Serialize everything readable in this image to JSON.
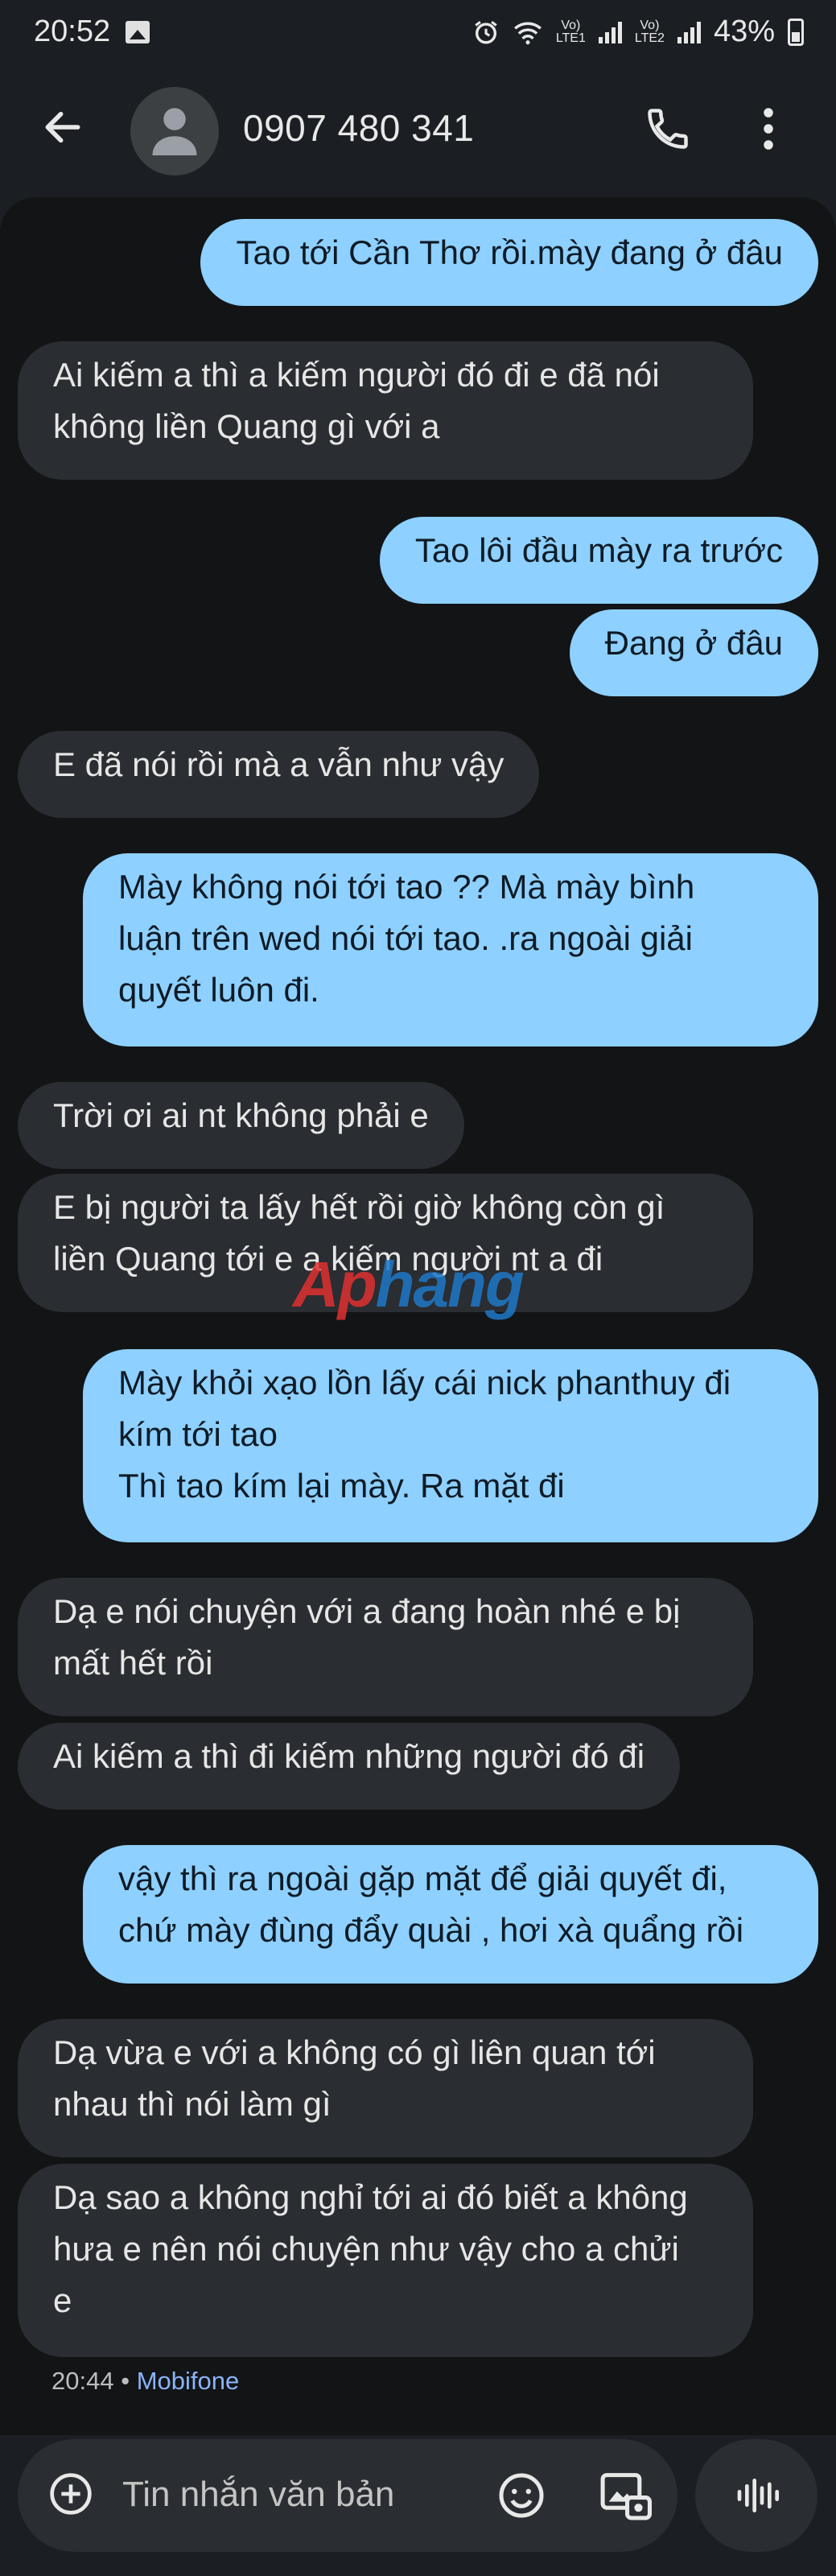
{
  "status_bar": {
    "time": "20:52",
    "battery": "43%",
    "sim1_label": "Vo)\nLTE1",
    "sim2_label": "Vo)\nLTE2",
    "icons": [
      "image-icon",
      "alarm-icon",
      "wifi-icon",
      "signal-icon",
      "battery-icon"
    ]
  },
  "app_bar": {
    "contact": "0907 480 341",
    "icons": [
      "back-arrow-icon",
      "person-icon",
      "phone-icon",
      "more-vert-icon"
    ]
  },
  "messages": [
    {
      "dir": "out",
      "text": "Tao tới Cần Thơ rồi.mày đang ở đâu"
    },
    {
      "dir": "in",
      "text": "Ai  kiếm a thì a kiếm người đó đi e đã nói\nkhông liền Quang gì với a"
    },
    {
      "dir": "out",
      "text": "Tao lôi  đầu mày ra trước"
    },
    {
      "dir": "out",
      "text": "Đang ở đâu"
    },
    {
      "dir": "in",
      "text": "E đã nói rồi mà a vẫn như vậy"
    },
    {
      "dir": "out",
      "text": "Mày không nói tới tao ?? Mà mày bình\nluận trên wed nói tới tao. .ra ngoài giải\nquyết luôn đi."
    },
    {
      "dir": "in",
      "text": "Trời ơi ai nt không phải e"
    },
    {
      "dir": "in",
      "text": "E bị người ta lấy hết rồi giờ không còn gì\nliền Quang tới e a kiếm người nt a đi"
    },
    {
      "dir": "out",
      "text": "Mày khỏi xạo lồn lấy cái nick phanthuy đi\nkím tới tao\nThì tao kím lại mày. Ra mặt đi"
    },
    {
      "dir": "in",
      "text": "Dạ e nói chuyện với a đang hoàn nhé e bị\nmất hết rồi"
    },
    {
      "dir": "in",
      "text": "Ai kiếm a thì đi kiếm những người đó đi"
    },
    {
      "dir": "out",
      "text": "vậy thì ra ngoài gặp mặt để giải quyết đi,\nchứ mày đùng đẩy quài , hơi xà quẩng rồi"
    },
    {
      "dir": "in",
      "text": "Dạ vừa e với a không có gì liên quan tới\nnhau thì nói làm gì"
    },
    {
      "dir": "in",
      "text": "Dạ sao a không nghỉ tới ai đó biết a không\nhưa e nên nói chuyện như vậy cho a chửi\ne"
    }
  ],
  "meta": {
    "time": "20:44",
    "separator": "•",
    "carrier": "Mobifone"
  },
  "watermark": {
    "part1": "Ap",
    "part2": "hang"
  },
  "composer": {
    "placeholder": "Tin nhắn văn bản",
    "icons": [
      "add-icon",
      "emoji-icon",
      "gallery-icon",
      "voice-icon"
    ]
  },
  "colors": {
    "incoming": "#2a2d31",
    "outgoing": "#8ed0ff",
    "background": "#121416",
    "carrier": "#8ab4f8"
  }
}
